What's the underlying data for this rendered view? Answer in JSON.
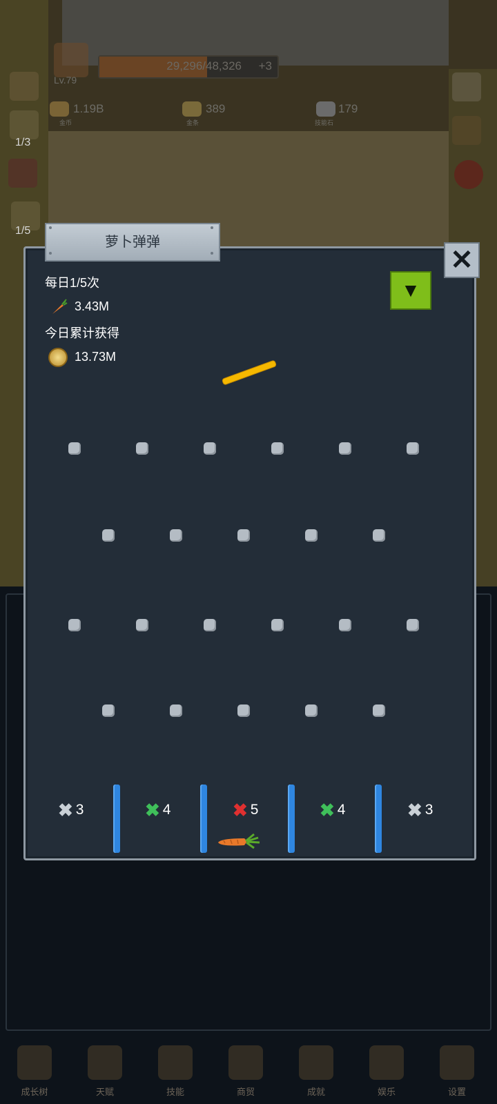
{
  "hud": {
    "level": "Lv.79",
    "xp_text": "29,296/48,326",
    "xp_progress": 0.606,
    "xp_bonus": "+3",
    "gold": "1.19B",
    "gold_label": "金币",
    "bars": "389",
    "bars_label": "金条",
    "skill_stone": "179",
    "skill_stone_label": "技能石",
    "side_counter_1": "1/3",
    "side_counter_2": "1/5"
  },
  "panel": {
    "title": "萝卜弹弹",
    "daily_label": "每日1/5次",
    "carrot_amount": "3.43M",
    "today_label": "今日累计获得",
    "coin_amount": "13.73M",
    "close_icon": "close-x-icon",
    "collapse_icon": "chevron-down-icon"
  },
  "slots": [
    {
      "label": "3",
      "color": "#c9d0d6"
    },
    {
      "label": "4",
      "color": "#3fbf5a"
    },
    {
      "label": "5",
      "color": "#e03030"
    },
    {
      "label": "4",
      "color": "#3fbf5a"
    },
    {
      "label": "3",
      "color": "#c9d0d6"
    }
  ],
  "nav": [
    {
      "label": "成长树",
      "icon": "book-icon"
    },
    {
      "label": "天赋",
      "icon": "scroll-icon"
    },
    {
      "label": "技能",
      "icon": "sword-icon"
    },
    {
      "label": "商贸",
      "icon": "map-icon"
    },
    {
      "label": "成就",
      "icon": "key-icon"
    },
    {
      "label": "娱乐",
      "icon": "scroll-icon"
    },
    {
      "label": "设置",
      "icon": "gear-icon"
    }
  ],
  "colors": {
    "panel_bg": "#232d38",
    "accent_green": "#7fbe1a",
    "paddle": "#f5b800",
    "divider": "#2f86e0"
  }
}
